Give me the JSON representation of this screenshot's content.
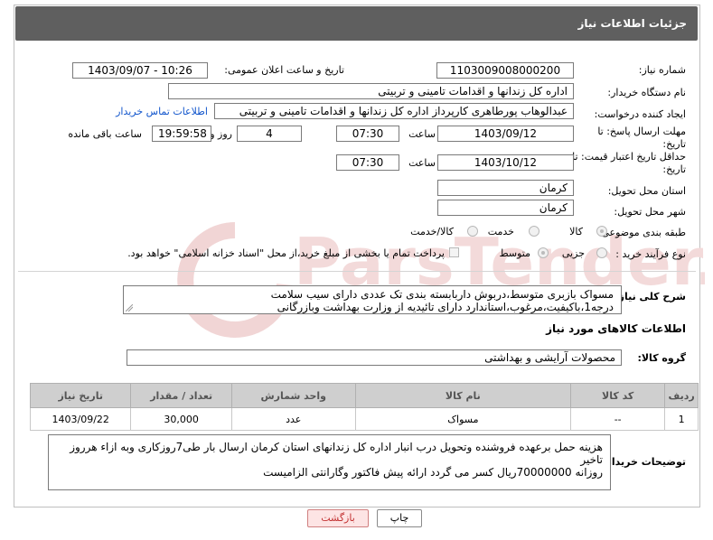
{
  "header": {
    "title": "جزئیات اطلاعات نیاز"
  },
  "form": {
    "need_number_label": "شماره نیاز:",
    "need_number": "1103009008000200",
    "announce_label": "تاریخ و ساعت اعلان عمومی:",
    "announce_value": "1403/09/07 - 10:26",
    "buyer_label": "نام دستگاه خریدار:",
    "buyer_value": "اداره کل زندانها و اقدامات تامینی و تربیتی",
    "creator_label": "ایجاد کننده درخواست:",
    "creator_value": "عبدالوهاب پورطاهری کارپرداز اداره کل زندانها و اقدامات تامینی و تربیتی",
    "contact_link": "اطلاعات تماس خریدار",
    "deadline_label_1": "مهلت ارسال پاسخ: تا",
    "deadline_label_2": "تاریخ:",
    "deadline_date": "1403/09/12",
    "time_label": "ساعت",
    "deadline_time": "07:30",
    "days_value": "4",
    "days_label": "روز و",
    "remaining_time": "19:59:58",
    "remaining_label": "ساعت باقی مانده",
    "validity_label_1": "حداقل تاریخ اعتبار قیمت: تا",
    "validity_label_2": "تاریخ:",
    "validity_date": "1403/10/12",
    "validity_time": "07:30",
    "province_label": "استان محل تحویل:",
    "province_value": "کرمان",
    "city_label": "شهر محل تحویل:",
    "city_value": "کرمان",
    "category_label": "طبقه بندی موضوعی:",
    "category_options": [
      "کالا",
      "خدمت",
      "کالا/خدمت"
    ],
    "process_label": "نوع فرآیند خرید :",
    "process_options": [
      "جزیی",
      "متوسط"
    ],
    "payment_text": "پرداخت تمام یا بخشی از مبلغ خرید،از محل \"اسناد خزانه اسلامی\" خواهد بود."
  },
  "description": {
    "label": "شرح کلی نیاز:",
    "line1": "مسواک بازبری متوسط،دربوش داربابسته بندی تک عددی دارای سیب سلامت",
    "line2": "درجه1،باکیفیت،مرغوب،استاندارد دارای تائیدیه از وزارت بهداشت وبازرگانی"
  },
  "goods_section": {
    "title": "اطلاعات کالاهای مورد نیاز",
    "group_label": "گروه کالا:",
    "group_value": "محصولات آرایشی و بهداشتی"
  },
  "table": {
    "headers": [
      "ردیف",
      "کد کالا",
      "نام کالا",
      "واحد شمارش",
      "تعداد / مقدار",
      "تاریخ نیاز"
    ],
    "rows": [
      {
        "row": "1",
        "code": "--",
        "name": "مسواک",
        "unit": "عدد",
        "qty": "30,000",
        "date": "1403/09/22"
      }
    ]
  },
  "buyer_notes": {
    "label": "توضیحات خریدار:",
    "line1": "هزینه حمل برعهده فروشنده وتحویل درب انبار اداره کل زندانهای استان کرمان ارسال بار طی7روزکاری وبه ازاء هرروز تاخیر",
    "line2": "روزانه 70000000ریال کسر می گردد ارائه پیش فاکتور وگارانتی الزامیست"
  },
  "buttons": {
    "print": "چاپ",
    "back": "بازگشت"
  },
  "colors": {
    "header_bg": "#5f5f5f",
    "link": "#1155cc",
    "back_btn_bg": "#fde4e4",
    "back_btn_text": "#c23030",
    "watermark": "#f0d0d0"
  },
  "watermark_text": "ParsTender.net"
}
